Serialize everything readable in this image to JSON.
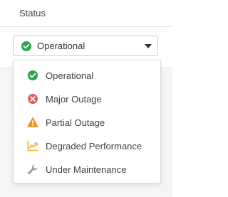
{
  "header": {
    "label": "Status"
  },
  "select": {
    "value": "Operational",
    "icon": "check-circle-icon"
  },
  "menu": {
    "items": [
      {
        "label": "Operational",
        "icon": "check-circle-icon",
        "color": "#2da44e"
      },
      {
        "label": "Major Outage",
        "icon": "x-circle-icon",
        "color": "#e25d5d"
      },
      {
        "label": "Partial Outage",
        "icon": "warning-triangle-icon",
        "color": "#f0932b"
      },
      {
        "label": "Degraded Performance",
        "icon": "trending-chart-icon",
        "color": "#f5b82e"
      },
      {
        "label": "Under Maintenance",
        "icon": "wrench-icon",
        "color": "#9aa0a6"
      }
    ]
  }
}
